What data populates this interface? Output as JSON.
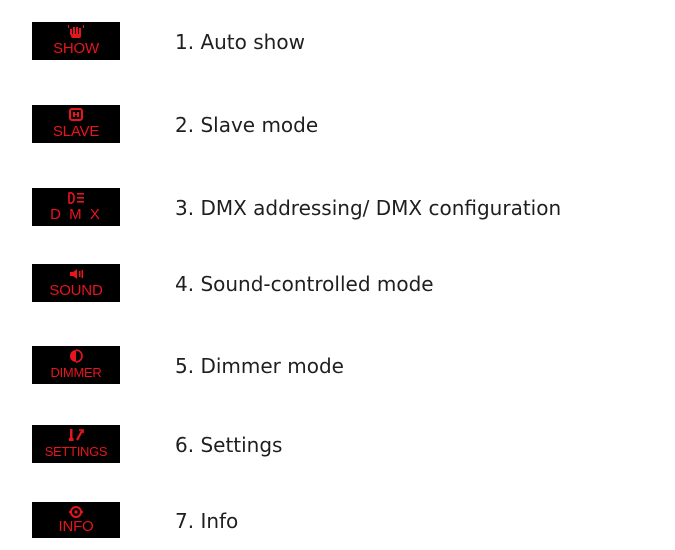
{
  "accent_color": "#e8141e",
  "key_background": "#000000",
  "items": [
    {
      "key_label": "SHOW",
      "icon": "hand-wave-icon",
      "text": "1. Auto show"
    },
    {
      "key_label": "SLAVE",
      "icon": "linked-devices-icon",
      "text": "2. Slave mode"
    },
    {
      "key_label": "D M X",
      "icon": "spotlight-icon",
      "text": "3. DMX addressing/ DMX configuration"
    },
    {
      "key_label": "SOUND",
      "icon": "speaker-icon",
      "text": "4. Sound-controlled mode"
    },
    {
      "key_label": "DIMMER",
      "icon": "dimmer-bulb-icon",
      "text": "5. Dimmer mode"
    },
    {
      "key_label": "SETTINGS",
      "icon": "tools-icon",
      "text": "6. Settings"
    },
    {
      "key_label": "INFO",
      "icon": "info-gear-icon",
      "text": "7. Info"
    }
  ]
}
